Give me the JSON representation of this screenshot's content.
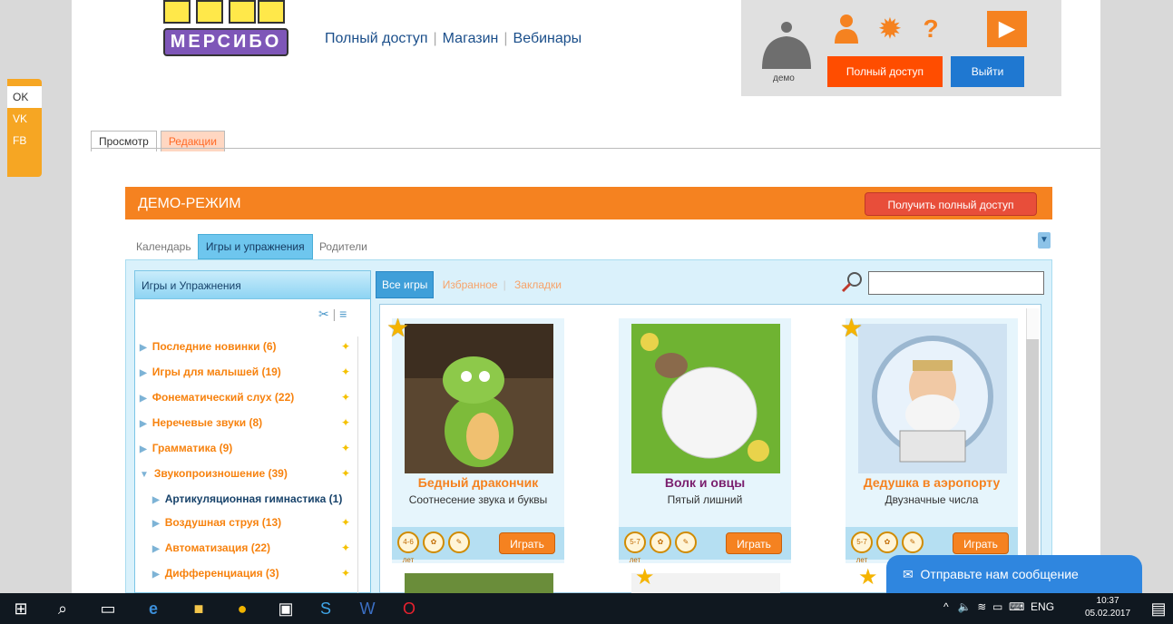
{
  "social": [
    "OK",
    "VK",
    "FB"
  ],
  "logo": {
    "text": "МЕРСИБО"
  },
  "topnav": [
    "Полный доступ",
    "Магазин",
    "Вебинары"
  ],
  "user": {
    "label": "демо",
    "full_access": "Полный доступ",
    "exit": "Выйти",
    "help": "?"
  },
  "view_tabs": [
    "Просмотр",
    "Редакции"
  ],
  "demo": {
    "title": "ДЕМО-РЕЖИМ",
    "get_full": "Получить полный доступ"
  },
  "sub_tabs": [
    "Календарь",
    "Игры и упражнения",
    "Родители"
  ],
  "left_panel": {
    "title": "Игры и Упражнения",
    "categories": [
      {
        "label": "Последние новинки (6)"
      },
      {
        "label": "Игры для малышей (19)"
      },
      {
        "label": "Фонематический слух (22)"
      },
      {
        "label": "Неречевые звуки (8)"
      },
      {
        "label": "Грамматика (9)"
      },
      {
        "label": "Звукопроизношение (39)"
      },
      {
        "label": "Артикуляционная гимнастика (1)"
      },
      {
        "label": "Воздушная струя (13)"
      },
      {
        "label": "Автоматизация (22)"
      },
      {
        "label": "Дифференциация (3)"
      }
    ]
  },
  "game_tabs": [
    "Все игры",
    "Избранное",
    "Закладки"
  ],
  "games": [
    {
      "title": "Бедный дракончик",
      "subtitle": "Соотнесение звука и буквы",
      "age": "4-6 лет",
      "play": "Играть",
      "title_color": "#f58220"
    },
    {
      "title": "Волк и овцы",
      "subtitle": "Пятый лишний",
      "age": "5-7 лет",
      "play": "Играть",
      "title_color": "#7a1f6e"
    },
    {
      "title": "Дедушка в аэропорту",
      "subtitle": "Двузначные числа",
      "age": "5-7 лет",
      "play": "Играть",
      "title_color": "#f58220"
    }
  ],
  "chat": {
    "label": "Отправьте нам сообщение"
  },
  "taskbar": {
    "lang": "ENG",
    "time": "10:37",
    "date": "05.02.2017"
  }
}
